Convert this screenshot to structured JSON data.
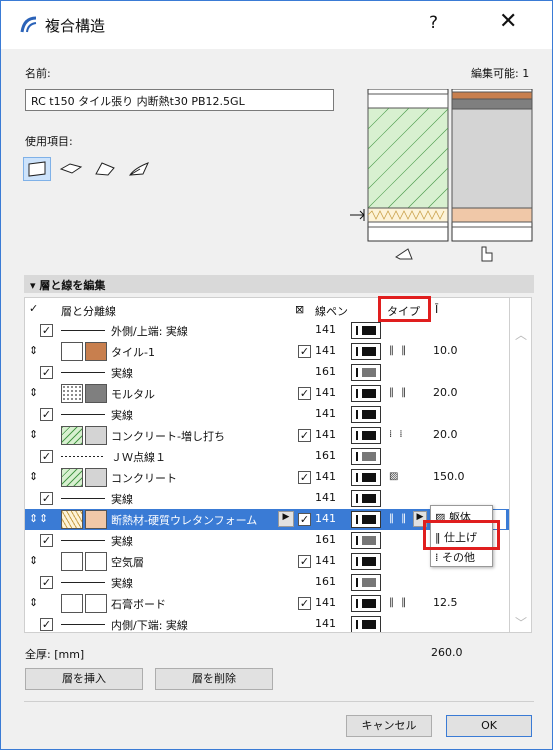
{
  "window": {
    "title": "複合構造",
    "help_label": "?",
    "close_label": "✕"
  },
  "name_label": "名前:",
  "editable_label": "編集可能: 1",
  "name_value": "RC t150 タイル張り 内断熱t30 PB12.5GL",
  "use_label": "使用項目:",
  "use_icons": [
    "wall-icon",
    "slab-icon",
    "roof-icon",
    "shell-icon"
  ],
  "section": {
    "title": "層と線を編集"
  },
  "table": {
    "headers": {
      "layer": "層と分離線",
      "pen": "線ペン",
      "type": "タイプ",
      "thickness": "Ī"
    },
    "rows": [
      {
        "kind": "line",
        "label": "外側/上端: 実線",
        "pen": "141",
        "dark": true
      },
      {
        "kind": "layer",
        "label": "タイル-1",
        "pen": "141",
        "fill": "#c87f4e",
        "pattern": "blank",
        "type": "‖ ‖",
        "thickness": "10.0"
      },
      {
        "kind": "line",
        "label": "実線",
        "pen": "161",
        "dark": false
      },
      {
        "kind": "layer",
        "label": "モルタル",
        "pen": "141",
        "fill": "#7f7f7f",
        "pattern": "dots",
        "type": "‖ ‖",
        "thickness": "20.0"
      },
      {
        "kind": "line",
        "label": "実線",
        "pen": "141",
        "dark": true
      },
      {
        "kind": "layer",
        "label": "コンクリート-増し打ち",
        "pen": "141",
        "fill": "#d4d4d4",
        "pattern": "hatch",
        "type": "⁞ ⁞",
        "thickness": "20.0"
      },
      {
        "kind": "line",
        "label": "ＪＷ点線１",
        "pen": "161",
        "dark": false,
        "dashed": true
      },
      {
        "kind": "layer",
        "label": "コンクリート",
        "pen": "141",
        "fill": "#d4d4d4",
        "pattern": "hatch",
        "type": "▨",
        "thickness": "150.0"
      },
      {
        "kind": "line",
        "label": "実線",
        "pen": "141",
        "dark": true
      },
      {
        "kind": "layer",
        "label": "断熱材-硬質ウレタンフォーム",
        "pen": "141",
        "fill": "#f0c8a8",
        "pattern": "zigzag",
        "type": "‖ ‖",
        "thickness": "",
        "selected": true
      },
      {
        "kind": "line",
        "label": "実線",
        "pen": "161",
        "dark": false
      },
      {
        "kind": "layer",
        "label": "空気層",
        "pen": "141",
        "fill": "#ffffff",
        "pattern": "blank",
        "type": "",
        "thickness": ""
      },
      {
        "kind": "line",
        "label": "実線",
        "pen": "161",
        "dark": false
      },
      {
        "kind": "layer",
        "label": "石膏ボード",
        "pen": "141",
        "fill": "#ffffff",
        "pattern": "blank",
        "type": "‖ ‖",
        "thickness": "12.5"
      },
      {
        "kind": "line",
        "label": "内側/下端: 実線",
        "pen": "141",
        "dark": true
      }
    ]
  },
  "popup": {
    "items": [
      "躯体",
      "仕上げ",
      "その他"
    ],
    "highlighted": 1
  },
  "total_label": "全厚: [mm]",
  "total_value": "260.0",
  "buttons": {
    "insert": "層を挿入",
    "delete": "層を削除",
    "cancel": "キャンセル",
    "ok": "OK"
  },
  "colors": {
    "accent": "#3a7bd5",
    "highlight": "#e01e1e"
  }
}
